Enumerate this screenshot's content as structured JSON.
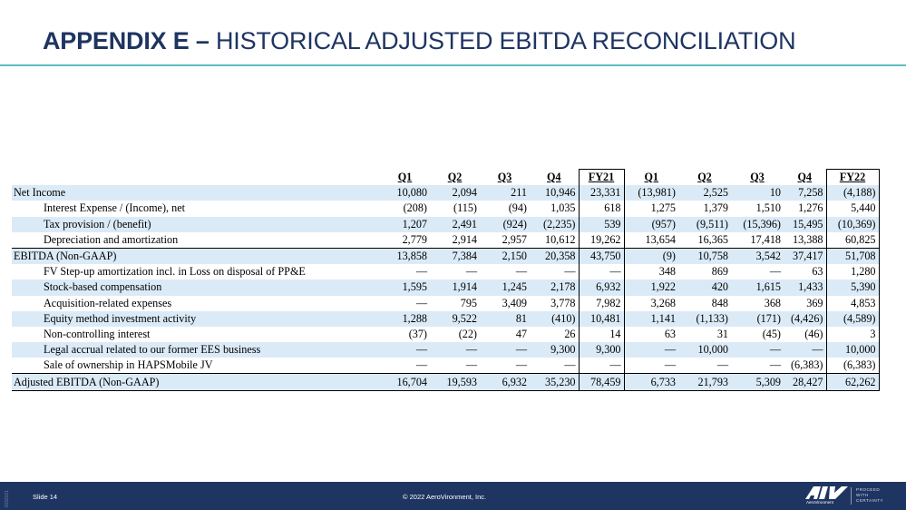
{
  "slide": {
    "title_bold": "APPENDIX E –",
    "title_rest": " HISTORICAL ADJUSTED EBITDA RECONCILIATION",
    "slide_number": "Slide 14",
    "copyright": "© 2022 AeroVironment, Inc.",
    "side_tag": "0932021",
    "logo_subtext": "AeroVironment",
    "tagline": [
      "PROCEED",
      "WITH",
      "CERTAINTY"
    ],
    "colors": {
      "title": "#1e3461",
      "accent_rule": "#5bbfbf",
      "footer_bg": "#1e3461",
      "row_shading": "#dbeaf7"
    }
  },
  "table": {
    "columns": [
      "Q1",
      "Q2",
      "Q3",
      "Q4",
      "FY21",
      "Q1",
      "Q2",
      "Q3",
      "Q4",
      "FY22"
    ],
    "rows": [
      {
        "label": "Net Income",
        "values": [
          "10,080",
          "2,094",
          "211",
          "10,946",
          "23,331",
          "(13,981)",
          "2,525",
          "10",
          "7,258",
          "(4,188)"
        ]
      },
      {
        "label": "Interest Expense / (Income), net",
        "values": [
          "(208)",
          "(115)",
          "(94)",
          "1,035",
          "618",
          "1,275",
          "1,379",
          "1,510",
          "1,276",
          "5,440"
        ]
      },
      {
        "label": "Tax provision / (benefit)",
        "values": [
          "1,207",
          "2,491",
          "(924)",
          "(2,235)",
          "539",
          "(957)",
          "(9,511)",
          "(15,396)",
          "15,495",
          "(10,369)"
        ]
      },
      {
        "label": "Depreciation and amortization",
        "values": [
          "2,779",
          "2,914",
          "2,957",
          "10,612",
          "19,262",
          "13,654",
          "16,365",
          "17,418",
          "13,388",
          "60,825"
        ]
      },
      {
        "label": "EBITDA (Non-GAAP)",
        "values": [
          "13,858",
          "7,384",
          "2,150",
          "20,358",
          "43,750",
          "(9)",
          "10,758",
          "3,542",
          "37,417",
          "51,708"
        ]
      },
      {
        "label": "FV Step-up amortization incl. in Loss on disposal of PP&E",
        "values": [
          "—",
          "—",
          "—",
          "—",
          "—",
          "348",
          "869",
          "—",
          "63",
          "1,280"
        ]
      },
      {
        "label": "Stock-based compensation",
        "values": [
          "1,595",
          "1,914",
          "1,245",
          "2,178",
          "6,932",
          "1,922",
          "420",
          "1,615",
          "1,433",
          "5,390"
        ]
      },
      {
        "label": "Acquisition-related expenses",
        "values": [
          "—",
          "795",
          "3,409",
          "3,778",
          "7,982",
          "3,268",
          "848",
          "368",
          "369",
          "4,853"
        ]
      },
      {
        "label": "Equity method investment activity",
        "values": [
          "1,288",
          "9,522",
          "81",
          "(410)",
          "10,481",
          "1,141",
          "(1,133)",
          "(171)",
          "(4,426)",
          "(4,589)"
        ]
      },
      {
        "label": "Non-controlling interest",
        "values": [
          "(37)",
          "(22)",
          "47",
          "26",
          "14",
          "63",
          "31",
          "(45)",
          "(46)",
          "3"
        ]
      },
      {
        "label": "Legal accrual related to our former EES business",
        "values": [
          "—",
          "—",
          "—",
          "9,300",
          "9,300",
          "—",
          "10,000",
          "—",
          "—",
          "10,000"
        ]
      },
      {
        "label": "Sale of ownership in HAPSMobile JV",
        "values": [
          "—",
          "—",
          "—",
          "—",
          "—",
          "—",
          "—",
          "—",
          "(6,383)",
          "(6,383)"
        ]
      },
      {
        "label": "Adjusted EBITDA (Non-GAAP)",
        "values": [
          "16,704",
          "19,593",
          "6,932",
          "35,230",
          "78,459",
          "6,733",
          "21,793",
          "5,309",
          "28,427",
          "62,262"
        ]
      }
    ]
  }
}
